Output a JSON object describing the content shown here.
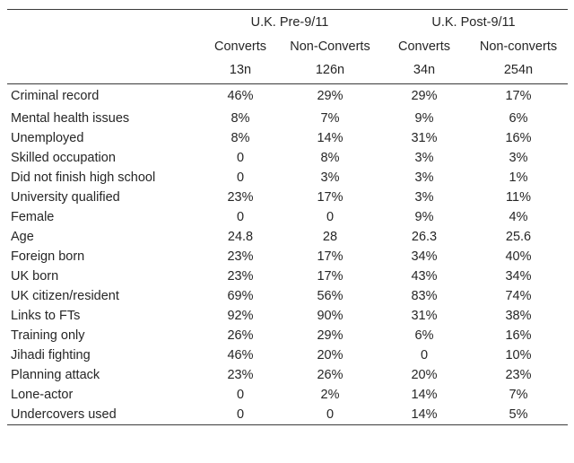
{
  "table": {
    "groups": [
      {
        "label": "U.K. Pre-9/11"
      },
      {
        "label": "U.K. Post-9/11"
      }
    ],
    "columns": [
      {
        "label": "Converts",
        "n": "13n"
      },
      {
        "label": "Non-Converts",
        "n": "126n"
      },
      {
        "label": "Converts",
        "n": "34n"
      },
      {
        "label": "Non-converts",
        "n": "254n"
      }
    ],
    "rows": [
      {
        "label": "Criminal record",
        "values": [
          "46%",
          "29%",
          "29%",
          "17%"
        ]
      },
      {
        "label": "Mental health issues",
        "values": [
          "8%",
          "7%",
          "9%",
          "6%"
        ]
      },
      {
        "label": "Unemployed",
        "values": [
          "8%",
          "14%",
          "31%",
          "16%"
        ]
      },
      {
        "label": "Skilled occupation",
        "values": [
          "0",
          "8%",
          "3%",
          "3%"
        ]
      },
      {
        "label": "Did not finish high school",
        "values": [
          "0",
          "3%",
          "3%",
          "1%"
        ]
      },
      {
        "label": "University qualified",
        "values": [
          "23%",
          "17%",
          "3%",
          "11%"
        ]
      },
      {
        "label": "Female",
        "values": [
          "0",
          "0",
          "9%",
          "4%"
        ]
      },
      {
        "label": "Age",
        "values": [
          "24.8",
          "28",
          "26.3",
          "25.6"
        ]
      },
      {
        "label": "Foreign born",
        "values": [
          "23%",
          "17%",
          "34%",
          "40%"
        ]
      },
      {
        "label": "UK born",
        "values": [
          "23%",
          "17%",
          "43%",
          "34%"
        ]
      },
      {
        "label": "UK citizen/resident",
        "values": [
          "69%",
          "56%",
          "83%",
          "74%"
        ]
      },
      {
        "label": "Links to FTs",
        "values": [
          "92%",
          "90%",
          "31%",
          "38%"
        ]
      },
      {
        "label": "Training only",
        "values": [
          "26%",
          "29%",
          "6%",
          "16%"
        ]
      },
      {
        "label": "Jihadi fighting",
        "values": [
          "46%",
          "20%",
          "0",
          "10%"
        ]
      },
      {
        "label": "Planning attack",
        "values": [
          "23%",
          "26%",
          "20%",
          "23%"
        ]
      },
      {
        "label": "Lone-actor",
        "values": [
          "0",
          "2%",
          "14%",
          "7%"
        ]
      },
      {
        "label": "Undercovers used",
        "values": [
          "0",
          "0",
          "14%",
          "5%"
        ]
      }
    ]
  },
  "style": {
    "rule_color": "#3a3a3a",
    "text_color": "#262626",
    "background": "#ffffff"
  }
}
